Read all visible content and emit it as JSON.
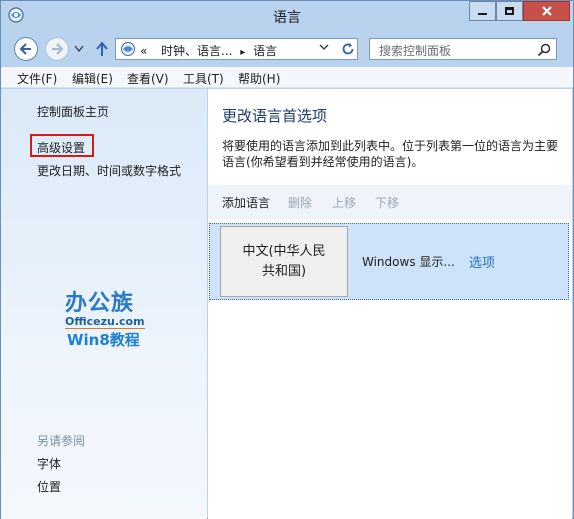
{
  "window": {
    "title": "语言"
  },
  "nav": {
    "address_overflow": "«",
    "breadcrumb_1": "时钟、语言...",
    "breadcrumb_sep": "▸",
    "breadcrumb_2": "语言",
    "search_placeholder": "搜索控制面板"
  },
  "menu": {
    "file": "文件(F)",
    "edit": "编辑(E)",
    "view": "查看(V)",
    "tools": "工具(T)",
    "help": "帮助(H)"
  },
  "sidebar": {
    "home": "控制面板主页",
    "advanced": "高级设置",
    "datetime": "更改日期、时间或数字格式",
    "see_also": "另请参阅",
    "fonts": "字体",
    "location": "位置"
  },
  "watermark": {
    "brand": "办公族",
    "url": "Officezu.com",
    "tagline": "Win8教程"
  },
  "main": {
    "title": "更改语言首选项",
    "description": "将要使用的语言添加到此列表中。位于列表第一位的语言为主要语言(你希望看到并经常使用的语言)。",
    "toolbar": {
      "add": "添加语言",
      "remove": "删除",
      "up": "上移",
      "down": "下移"
    },
    "languages": [
      {
        "name": "中文(中华人民共和国)",
        "status": "Windows 显示...",
        "options": "选项"
      }
    ]
  },
  "colors": {
    "frame": "#b9d3ee",
    "highlight_border": "#d61a1a",
    "link_blue": "#2a6fbf",
    "selected_row": "#cde3fa"
  }
}
